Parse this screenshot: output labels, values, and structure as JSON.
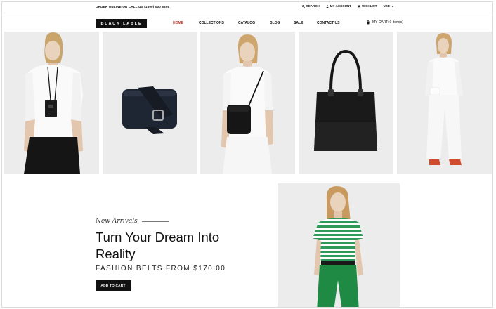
{
  "topbar": {
    "phone_text": "ORDER ONLINE OR CALL US (1800) 000 8808",
    "search_label": "SEARCH",
    "account_label": "MY ACCOUNT",
    "wishlist_label": "WISHLIST",
    "currency_label": "USD"
  },
  "header": {
    "logo_text": "BLACK LABLE",
    "nav": [
      {
        "label": "HOME"
      },
      {
        "label": "COLLECTIONS"
      },
      {
        "label": "CATALOG"
      },
      {
        "label": "BLOG"
      },
      {
        "label": "SALE"
      },
      {
        "label": "CONTACT US"
      }
    ],
    "cart_label": "MY CART: 0 item(s)"
  },
  "hero": {
    "eyebrow": "New Arrivals",
    "headline_line1": "Turn Your Dream Into",
    "headline_line2": "Reality",
    "subline": "FASHION BELTS FROM $170.00",
    "cta_label": "ADD TO CART"
  },
  "colors": {
    "accent": "#c0392b",
    "black": "#111111",
    "tile_bg": "#ececec"
  }
}
